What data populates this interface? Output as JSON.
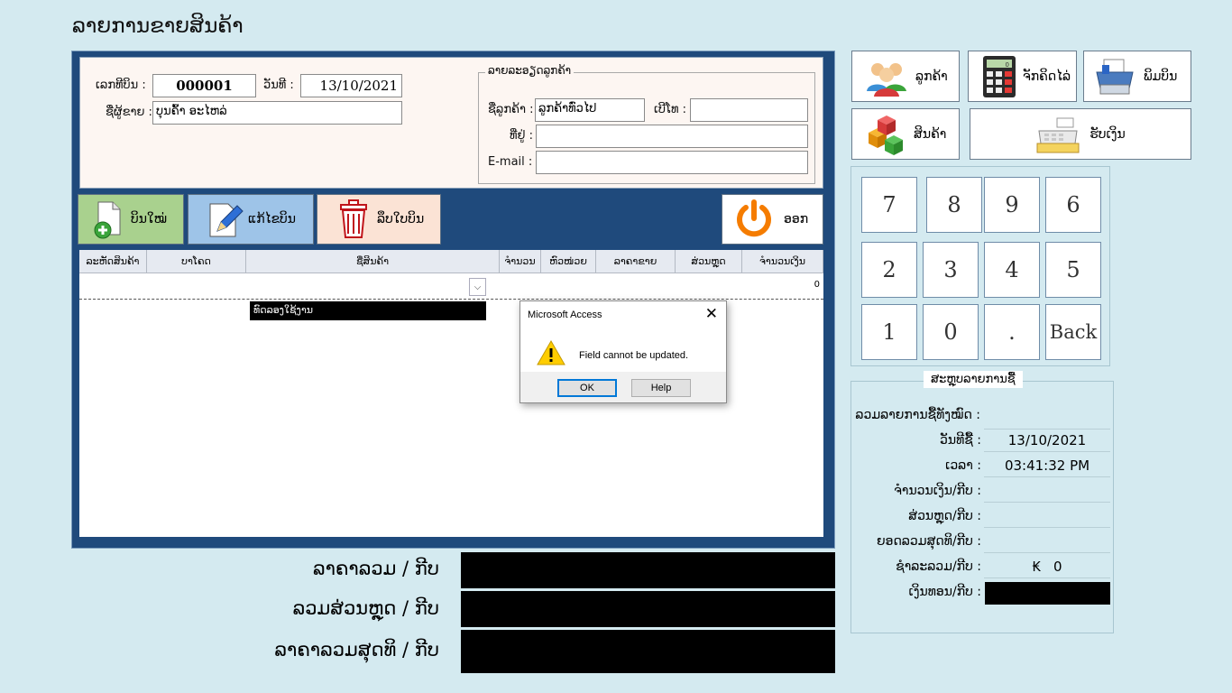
{
  "title": "ລາຍການຂາຍສິນຄ້າ",
  "header": {
    "bill_no_label": "ເລກທີບິນ :",
    "bill_no": "000001",
    "date_label": "ວັນທີ :",
    "date": "13/10/2021",
    "seller_label": "ຊື່ຜູ້ຂາຍ :",
    "seller": "ບຸນຄົ້າ ອະໄຫລ່",
    "customer_group_title": "ລາຍລະອຽດລູກຄ້າ",
    "customer_name_label": "ຊື່ລູກຄ້າ :",
    "customer_name": "ລູກຄ້າທົ່ວໄປ",
    "phone_label": "ເບີໂທ :",
    "phone": "",
    "address_label": "ທີ່ຢູ່ :",
    "address": "",
    "email_label": "E-mail :",
    "email": ""
  },
  "toolbar": {
    "new_bill": "ບິນໃໝ່",
    "edit_bill": "ແກ້ໄຂບິນ",
    "delete_bill": "ລຶບໃບບິນ",
    "exit": "ອອກ"
  },
  "grid": {
    "columns": [
      "ລະຫັດສິນຄ້າ",
      "ບາໂຄດ",
      "ຊື່ສິນຄ້າ",
      "ຈຳນວນ",
      "ຫົວໜ່ວຍ",
      "ລາຄາຂາຍ",
      "ສ່ວນຫຼຸດ",
      "ຈຳນວນເງິນ"
    ],
    "row_amount": "0",
    "tooltip": "ທົດລອງໃຊ້ງານ"
  },
  "side_buttons": {
    "customer": "ລູກຄ້າ",
    "calculator": "ຈັກຄິດໄລ່",
    "print": "ພິມບິນ",
    "product": "ສິນຄ້າ",
    "receive": "ຮັບເງິນ",
    "calc_display": "0"
  },
  "keypad": {
    "keys": [
      "7",
      "8",
      "9",
      "6",
      "2",
      "3",
      "4",
      "5",
      "1",
      "0",
      ".",
      "Back"
    ]
  },
  "summary": {
    "title": "ສະຫຼຸບລາຍການຊື້",
    "total_items_label": "ລວມລາຍການຊື້ທັງໝົດ :",
    "purchase_date_label": "ວັນທີຊື້ :",
    "purchase_date": "13/10/2021",
    "time_label": "ເວລາ :",
    "time": "03:41:32 PM",
    "amount_label": "ຈຳນວນເງິນ/ກີບ :",
    "discount_label": "ສ່ວນຫຼຸດ/ກີບ :",
    "net_label": "ຍອດລວມສຸດທິ/ກີບ :",
    "paid_label": "ຊຳລະລວມ/ກີບ :",
    "paid_currency": "₭",
    "paid_value": "0",
    "change_label": "ເງິນທອນ/ກີບ :"
  },
  "totals": {
    "total_label": "ລາຄາລວມ / ກີບ",
    "discount_label": "ລວມສ່ວນຫຼຸດ / ກີບ",
    "net_label": "ລາຄາລວມສຸດທິ / ກີບ"
  },
  "dialog": {
    "title": "Microsoft Access",
    "message": "Field cannot be updated.",
    "ok": "OK",
    "help": "Help"
  }
}
